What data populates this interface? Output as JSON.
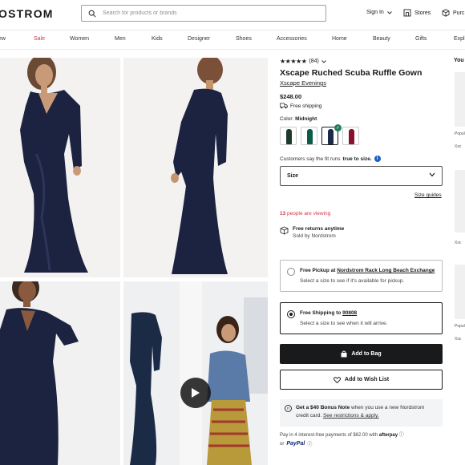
{
  "header": {
    "logo": "OSTROM",
    "search_placeholder": "Search for products or brands",
    "signin": "Sign In",
    "stores": "Stores",
    "purchases": "Purc"
  },
  "nav": [
    "ew",
    "Sale",
    "Women",
    "Men",
    "Kids",
    "Designer",
    "Shoes",
    "Accessories",
    "Home",
    "Beauty",
    "Gifts",
    "Expl"
  ],
  "product": {
    "rating_count": "(84)",
    "rating_value": 4.5,
    "title": "Xscape Ruched Scuba Ruffle Gown",
    "brand": "Xscape Evenings",
    "price": "$248.00",
    "free_shipping": "Free shipping",
    "color_label": "Color:",
    "color_value": "Midnight",
    "fit_prefix": "Customers say the fit runs",
    "fit_value": "true to size.",
    "size_label": "Size",
    "size_guides": "Size guides",
    "viewing_count": "13",
    "viewing_text": "people are viewing",
    "returns_title": "Free returns anytime",
    "returns_sub": "Sold by Nordstrom"
  },
  "swatch_colors": [
    "#1e3a2a",
    "#0c5a4a",
    "#1c2a4a",
    "#8a1030"
  ],
  "pickup": {
    "title_prefix": "Free Pickup at",
    "store": "Nordstrom Rack Long Beach Exchange",
    "sub": "Select a size to see if it's available for pickup."
  },
  "shipping": {
    "title_prefix": "Free Shipping to",
    "zip": "90808",
    "sub": "Select a size to see when it will arrive."
  },
  "buttons": {
    "add_to_bag": "Add to Bag",
    "add_to_wishlist": "Add to Wish List"
  },
  "bonus": {
    "bold": "Get a $40 Bonus Note",
    "rest": "when you use a new Nordstrom credit card.",
    "link": "See restrictions & apply."
  },
  "payments": {
    "afterpay_text": "Pay in 4 interest-free payments of $62.00 with",
    "afterpay_brand": "afterpay",
    "or": "or",
    "paypal": "PayPal"
  },
  "sidebar": {
    "title": "You",
    "labels": [
      "Popul",
      "Xsc",
      "Xsc",
      "Popul",
      "Xsc"
    ]
  },
  "colors": {
    "sale_red": "#d7344a",
    "check_green": "#1f7d5c",
    "info_blue": "#1861c6",
    "dress_navy": "#1c2340"
  }
}
